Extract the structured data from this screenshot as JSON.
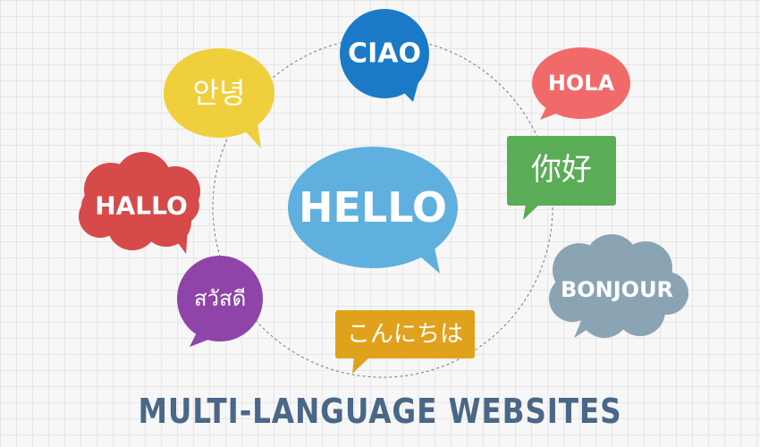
{
  "colors": {
    "background": "#f7f7f7",
    "grid": "#e6e6e6",
    "circle_dash": "#777777",
    "hello": "#5fb0df",
    "ciao": "#1a7ac8",
    "annyeong": "#efcf3b",
    "hola": "#f16a6a",
    "nihao": "#5aac57",
    "hallo": "#d64a4a",
    "bonjour": "#8aa4b3",
    "sawasdee": "#8e44a8",
    "konnichiwa": "#e0a21c",
    "caption": "#4a6787"
  },
  "greetings": {
    "hello": "HELLO",
    "ciao": "CIAO",
    "annyeong": "안녕",
    "hola": "HOLA",
    "nihao": "你好",
    "hallo": "HALLO",
    "bonjour": "BONJOUR",
    "sawasdee": "สวัสดี",
    "konnichiwa": "こんにちは"
  },
  "caption": "MULTI-LANGUAGE WEBSITES"
}
